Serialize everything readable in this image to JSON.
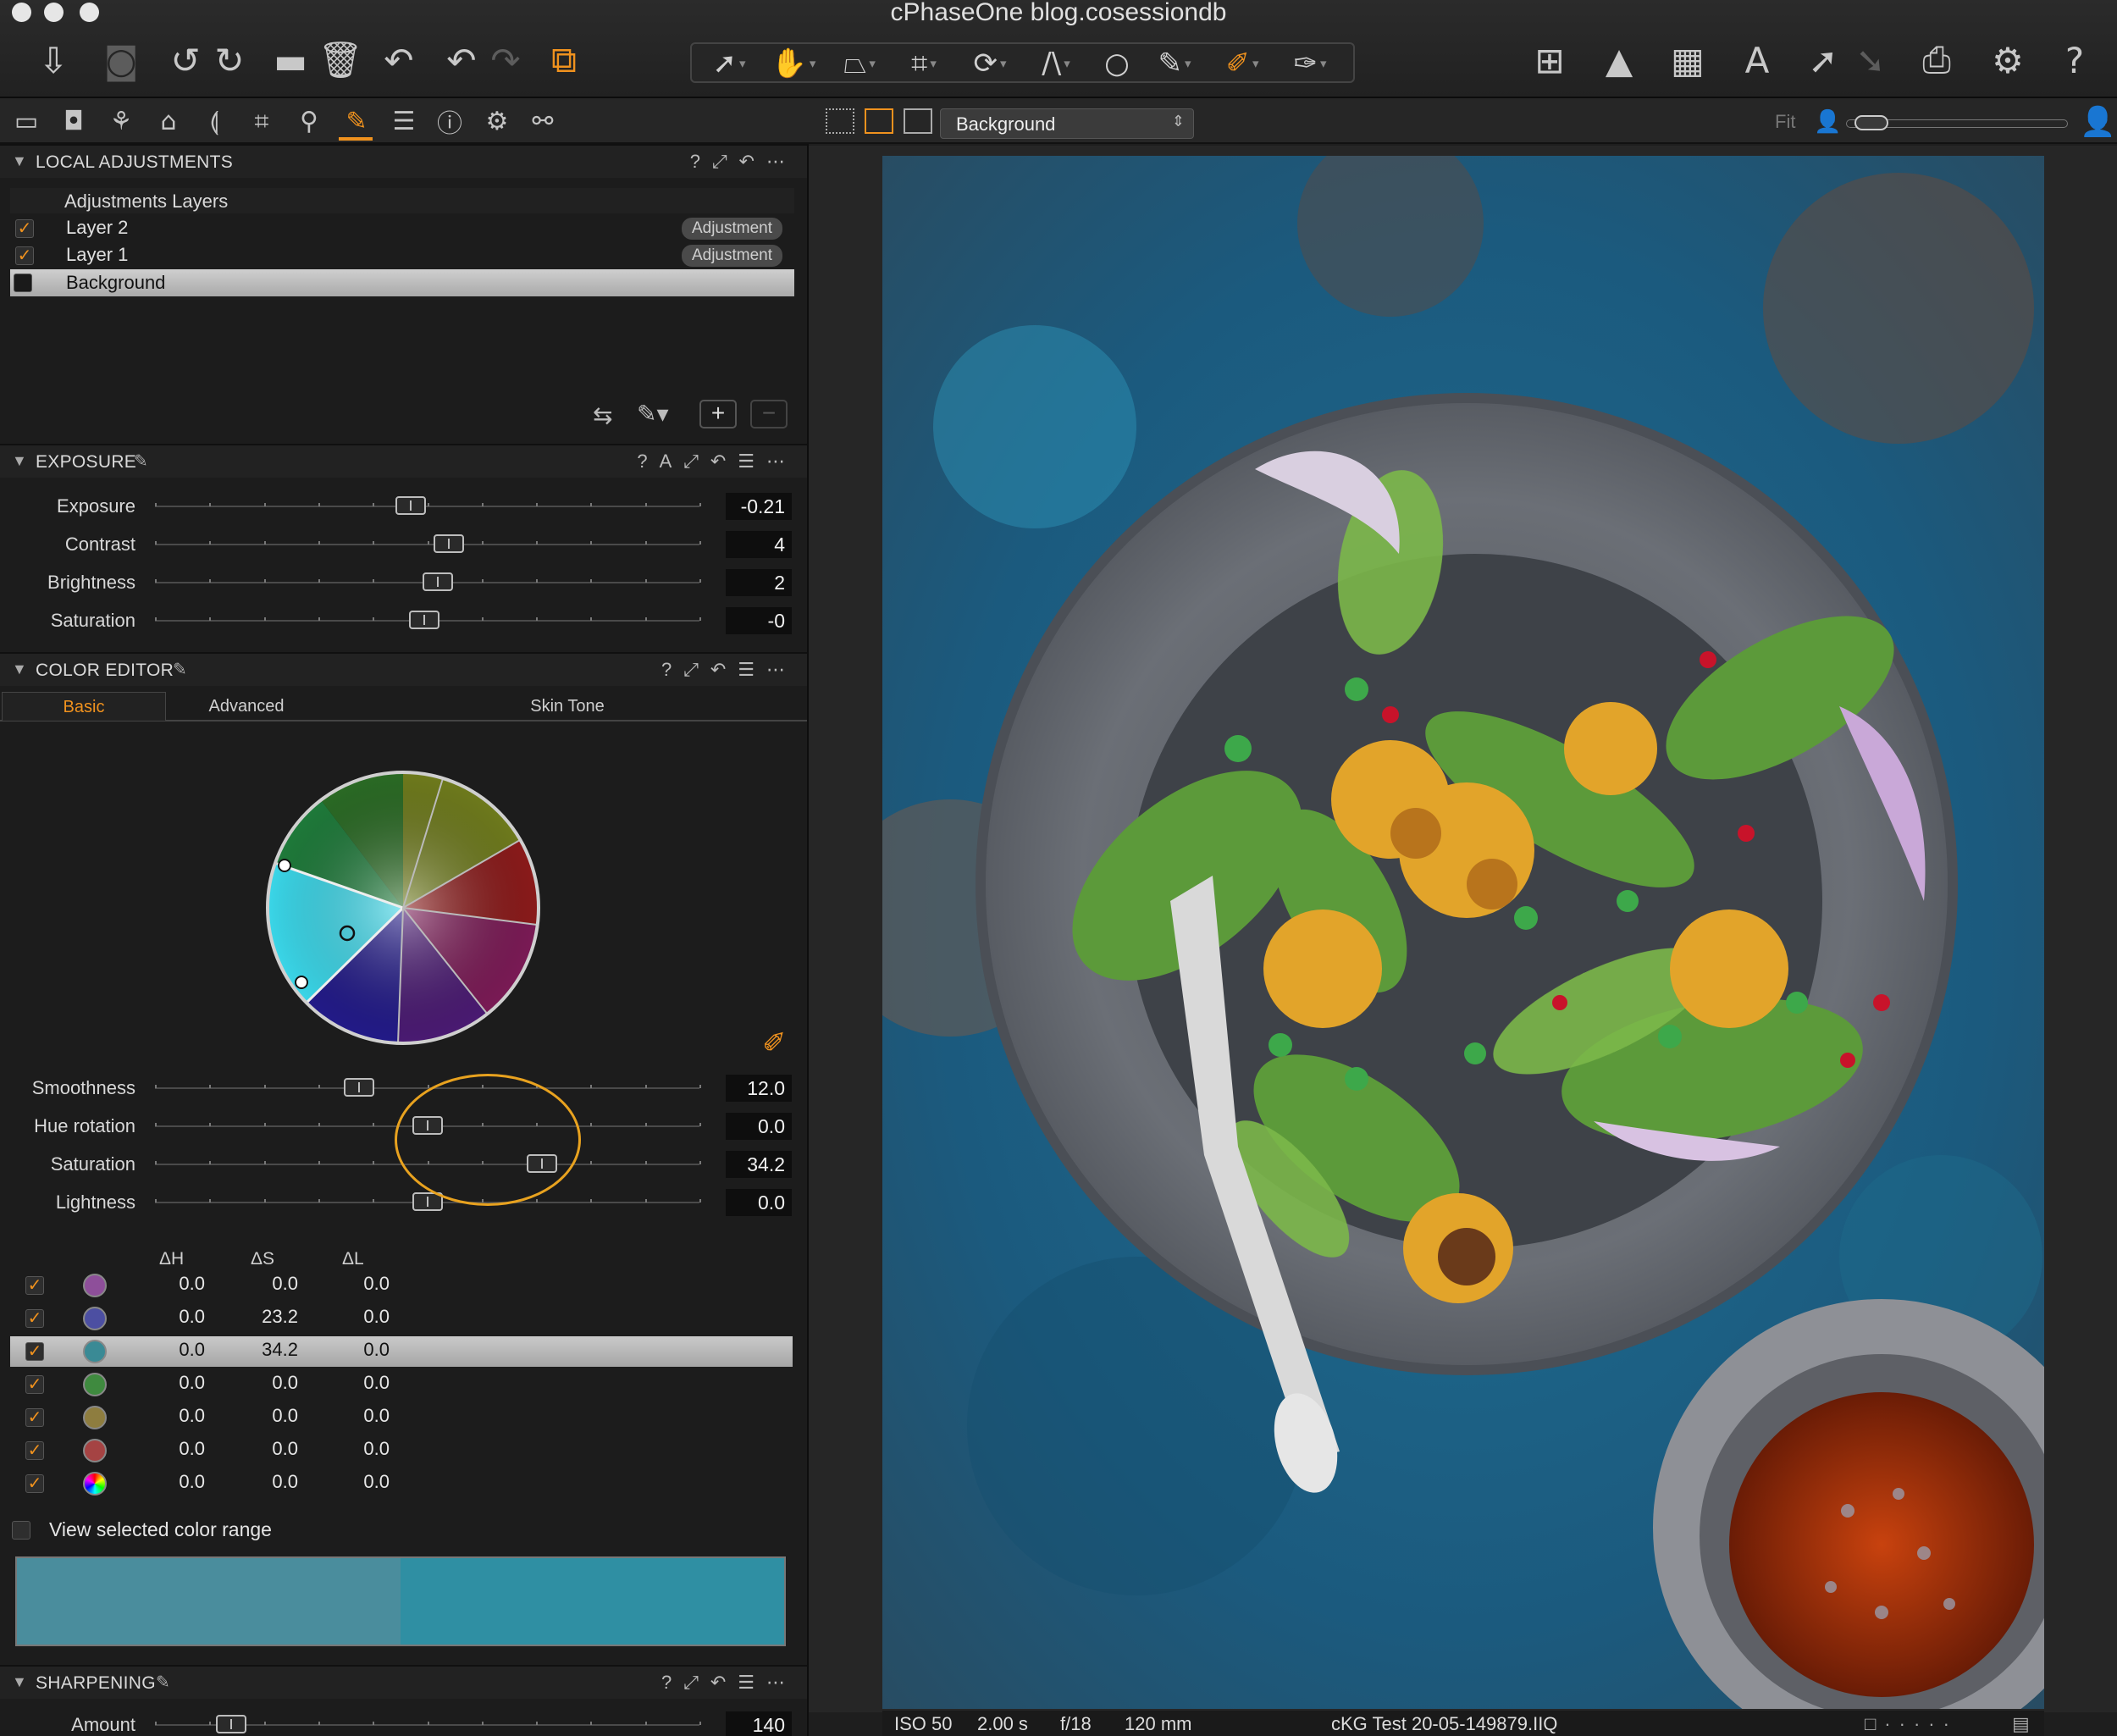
{
  "window": {
    "title": "cPhaseOne blog.cosessiondb"
  },
  "viewer": {
    "layer_select": "Background",
    "fit_label": "Fit"
  },
  "local_adjustments": {
    "title": "LOCAL ADJUSTMENTS",
    "layers_header": "Adjustments Layers",
    "layers": [
      {
        "name": "Layer 2",
        "badge": "Adjustment",
        "checked": true
      },
      {
        "name": "Layer 1",
        "badge": "Adjustment",
        "checked": true
      },
      {
        "name": "Background",
        "badge": "",
        "checked": false,
        "selected": true
      }
    ]
  },
  "exposure": {
    "title": "EXPOSURE",
    "sliders": [
      {
        "label": "Exposure",
        "value": "-0.21",
        "position": 0.47
      },
      {
        "label": "Contrast",
        "value": "4",
        "position": 0.54
      },
      {
        "label": "Brightness",
        "value": "2",
        "position": 0.52
      },
      {
        "label": "Saturation",
        "value": "-0",
        "position": 0.495
      }
    ]
  },
  "color_editor": {
    "title": "COLOR EDITOR",
    "tabs": [
      "Basic",
      "Advanced",
      "Skin Tone"
    ],
    "active_tab": "Basic",
    "sliders": [
      {
        "label": "Smoothness",
        "value": "12.0",
        "position": 0.375
      },
      {
        "label": "Hue rotation",
        "value": "0.0",
        "position": 0.5
      },
      {
        "label": "Saturation",
        "value": "34.2",
        "position": 0.71
      },
      {
        "label": "Lightness",
        "value": "0.0",
        "position": 0.5
      }
    ],
    "grid_headers": [
      "ΔH",
      "ΔS",
      "ΔL"
    ],
    "rows": [
      {
        "color": "#8e4f9a",
        "dh": "0.0",
        "ds": "0.0",
        "dl": "0.0"
      },
      {
        "color": "#4c4fa2",
        "dh": "0.0",
        "ds": "23.2",
        "dl": "0.0"
      },
      {
        "color": "#3a8a95",
        "dh": "0.0",
        "ds": "34.2",
        "dl": "0.0",
        "selected": true
      },
      {
        "color": "#3f8a3f",
        "dh": "0.0",
        "ds": "0.0",
        "dl": "0.0"
      },
      {
        "color": "#8e7d3f",
        "dh": "0.0",
        "ds": "0.0",
        "dl": "0.0"
      },
      {
        "color": "#a54343",
        "dh": "0.0",
        "ds": "0.0",
        "dl": "0.0"
      },
      {
        "color": "rainbow",
        "dh": "0.0",
        "ds": "0.0",
        "dl": "0.0"
      }
    ],
    "view_range_label": "View selected color range",
    "range_colors": [
      "#4a8d9d",
      "#2f8fa3"
    ]
  },
  "sharpening": {
    "title": "SHARPENING",
    "slider": {
      "label": "Amount",
      "value": "140",
      "position": 0.14
    }
  },
  "status": {
    "iso": "ISO 50",
    "shutter": "2.00 s",
    "aperture": "f/18",
    "focal": "120 mm",
    "filename": "cKG Test 20-05-149879.IIQ"
  },
  "colors": {
    "accent": "#f0921e",
    "panel": "#1c1c1c",
    "toolbar": "#262626"
  }
}
